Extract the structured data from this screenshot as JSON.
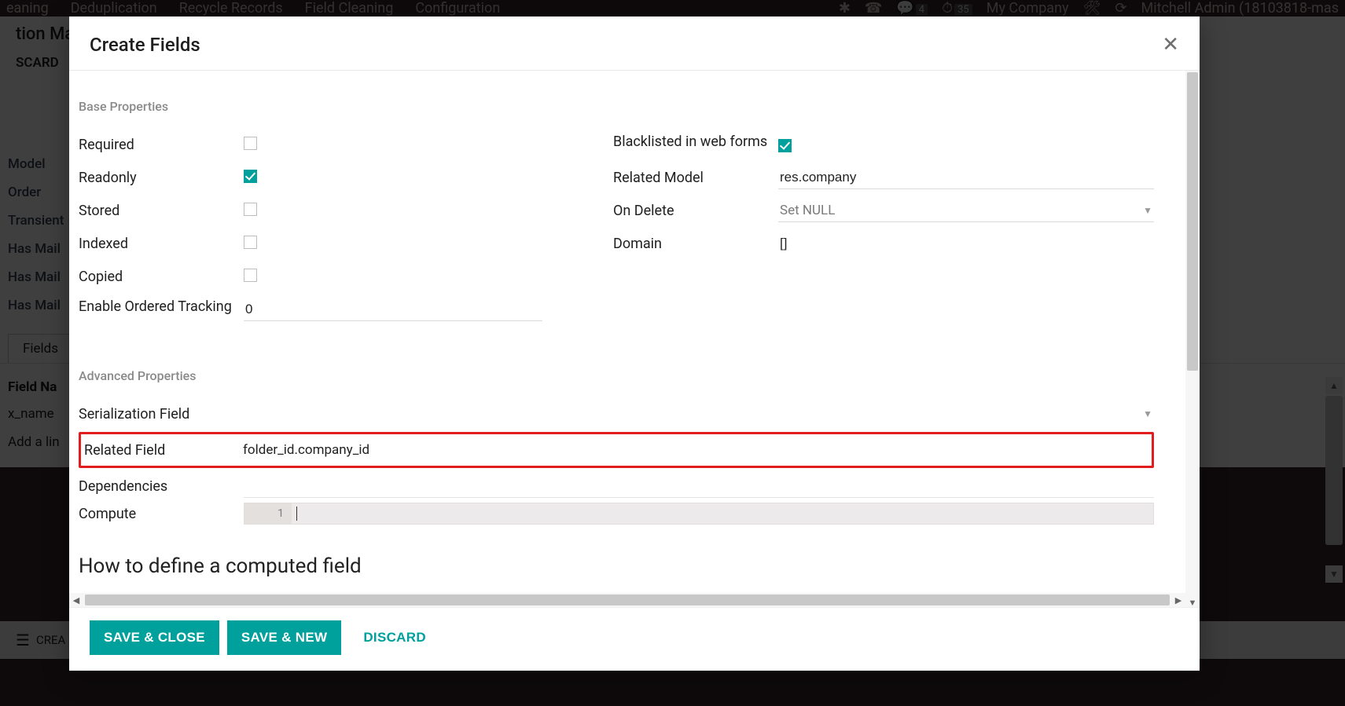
{
  "bg": {
    "topbar": {
      "items_left": [
        "eaning",
        "Deduplication",
        "Recycle Records",
        "Field Cleaning",
        "Configuration"
      ],
      "msg_count": "4",
      "clock_count": "35",
      "company": "My Company",
      "user": "Mitchell Admin (18103818-mas"
    },
    "title": "tion Ma",
    "discard": "SCARD",
    "fields": [
      "Model",
      "Order",
      "Transient",
      "Has Mail",
      "Has Mail",
      "Has Mail"
    ],
    "tab": "Fields",
    "th": "Field Na",
    "row1": "x_name",
    "row2": "Add a lin",
    "actionbar": "CREA"
  },
  "modal": {
    "title": "Create Fields",
    "sections": {
      "base": "Base Properties",
      "advanced": "Advanced Properties"
    },
    "left": {
      "required": "Required",
      "readonly": "Readonly",
      "stored": "Stored",
      "indexed": "Indexed",
      "copied": "Copied",
      "enable_ordered_tracking": "Enable Ordered Tracking",
      "enable_ordered_tracking_value": "0"
    },
    "right": {
      "blacklisted": "Blacklisted in web forms",
      "related_model": "Related Model",
      "related_model_value": "res.company",
      "on_delete": "On Delete",
      "on_delete_value": "Set NULL",
      "domain": "Domain",
      "domain_value": "[]"
    },
    "advanced": {
      "serialization": "Serialization Field",
      "related_field": "Related Field",
      "related_field_value": "folder_id.company_id",
      "dependencies": "Dependencies",
      "compute": "Compute",
      "compute_line": "1"
    },
    "cut_heading": "How to define a computed field",
    "footer": {
      "save_close": "Save & Close",
      "save_new": "Save & New",
      "discard": "Discard"
    }
  }
}
